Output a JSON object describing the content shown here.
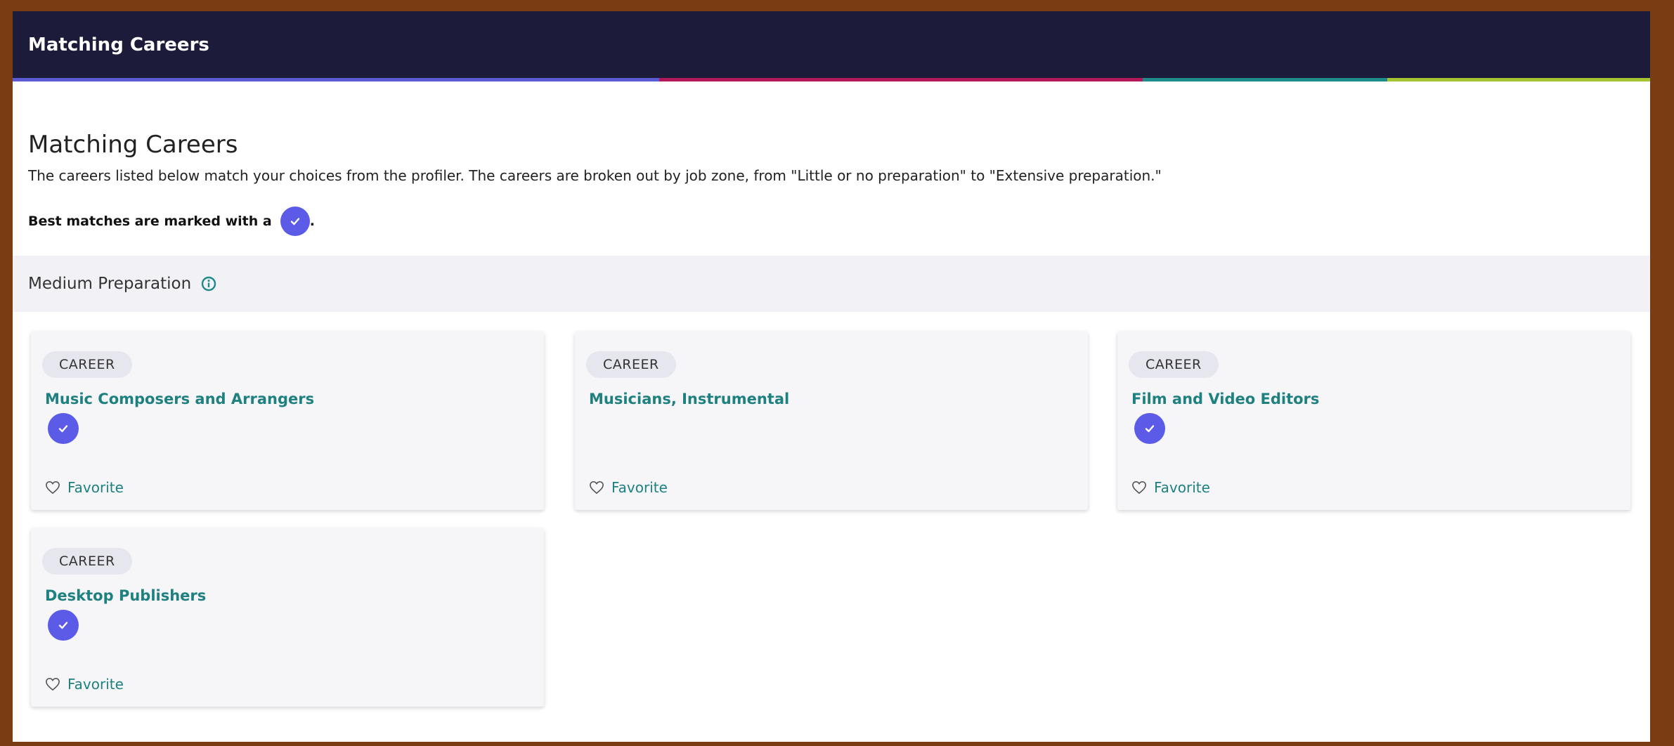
{
  "header": {
    "title": "Matching Careers",
    "bar_colors": [
      "#5b5bd6",
      "#b3185a",
      "#1e8a8a",
      "#a5c431"
    ]
  },
  "intro": {
    "heading": "Matching Careers",
    "description": "The careers listed below match your choices from the profiler. The careers are broken out by job zone, from \"Little or no preparation\" to \"Extensive preparation.\"",
    "best_matches_label": "Best matches are marked with a",
    "best_matches_suffix": "."
  },
  "section": {
    "label": "Medium Preparation",
    "info_icon": "info-icon"
  },
  "cards": [
    {
      "tag": "CAREER",
      "title": "Music Composers and Arrangers",
      "best_match": true,
      "favorite_label": "Favorite"
    },
    {
      "tag": "CAREER",
      "title": "Musicians, Instrumental",
      "best_match": false,
      "favorite_label": "Favorite"
    },
    {
      "tag": "CAREER",
      "title": "Film and Video Editors",
      "best_match": true,
      "favorite_label": "Favorite"
    },
    {
      "tag": "CAREER",
      "title": "Desktop Publishers",
      "best_match": true,
      "favorite_label": "Favorite"
    }
  ],
  "colors": {
    "header_bg": "#1c1c3a",
    "accent_check": "#5b5be8",
    "link_teal": "#1f8080",
    "page_border": "#7a3d12"
  }
}
